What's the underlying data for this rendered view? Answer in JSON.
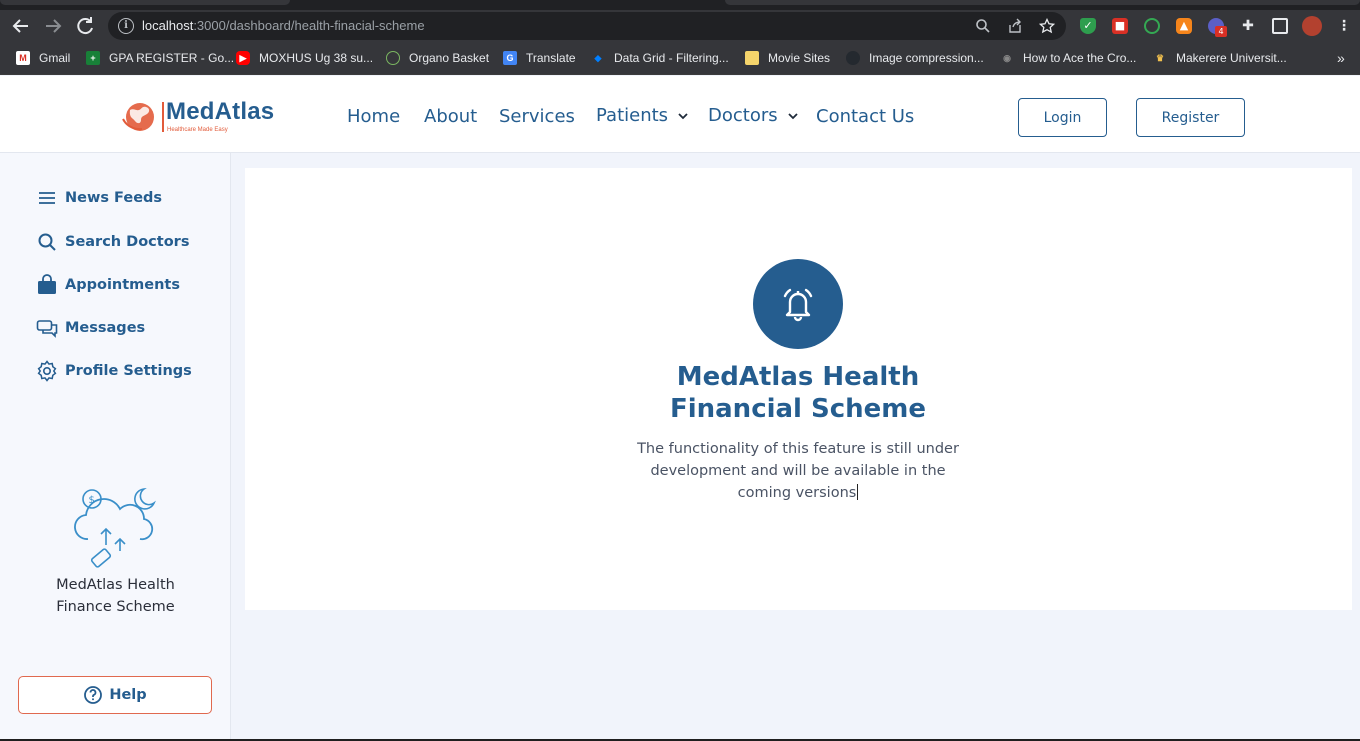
{
  "browser": {
    "url_host": "localhost",
    "url_path": ":3000/dashboard/health-finacial-scheme",
    "bookmarks": [
      {
        "label": "Gmail",
        "icon": "gmail-icon"
      },
      {
        "label": "GPA REGISTER - Go...",
        "icon": "sheets-icon"
      },
      {
        "label": "MOXHUS Ug 38 su...",
        "icon": "youtube-icon"
      },
      {
        "label": "Organo Basket",
        "icon": "organo-icon"
      },
      {
        "label": "Translate",
        "icon": "translate-icon"
      },
      {
        "label": "Data Grid - Filtering...",
        "icon": "mui-icon"
      },
      {
        "label": "Movie Sites",
        "icon": "folder-icon"
      },
      {
        "label": "Image compression...",
        "icon": "github-icon"
      },
      {
        "label": "How to Ace the Cro...",
        "icon": "eye-icon"
      },
      {
        "label": "Makerere Universit...",
        "icon": "makerere-icon"
      }
    ],
    "extension_badge": "4",
    "overflow": "»"
  },
  "header": {
    "brand": "MedAtlas",
    "tagline": "Healthcare Made Easy",
    "nav": {
      "home": "Home",
      "about": "About",
      "services": "Services",
      "patients": "Patients",
      "doctors": "Doctors",
      "contact": "Contact Us"
    },
    "login": "Login",
    "register": "Register"
  },
  "sidebar": {
    "items": [
      {
        "label": "News Feeds",
        "icon": "menu-icon"
      },
      {
        "label": "Search Doctors",
        "icon": "search-icon"
      },
      {
        "label": "Appointments",
        "icon": "bag-icon"
      },
      {
        "label": "Messages",
        "icon": "chat-icon"
      },
      {
        "label": "Profile Settings",
        "icon": "gear-icon"
      }
    ],
    "promo_line1": "MedAtlas Health",
    "promo_line2": "Finance Scheme",
    "help": "Help"
  },
  "main": {
    "title_line1": "MedAtlas Health",
    "title_line2": "Financial Scheme",
    "desc_line1": "The functionality of this feature is still under",
    "desc_line2": "development and will be available in the",
    "desc_line3": "coming versions"
  },
  "colors": {
    "primary": "#255d8f",
    "accent": "#e25b3a",
    "background": "#f1f4fb"
  }
}
